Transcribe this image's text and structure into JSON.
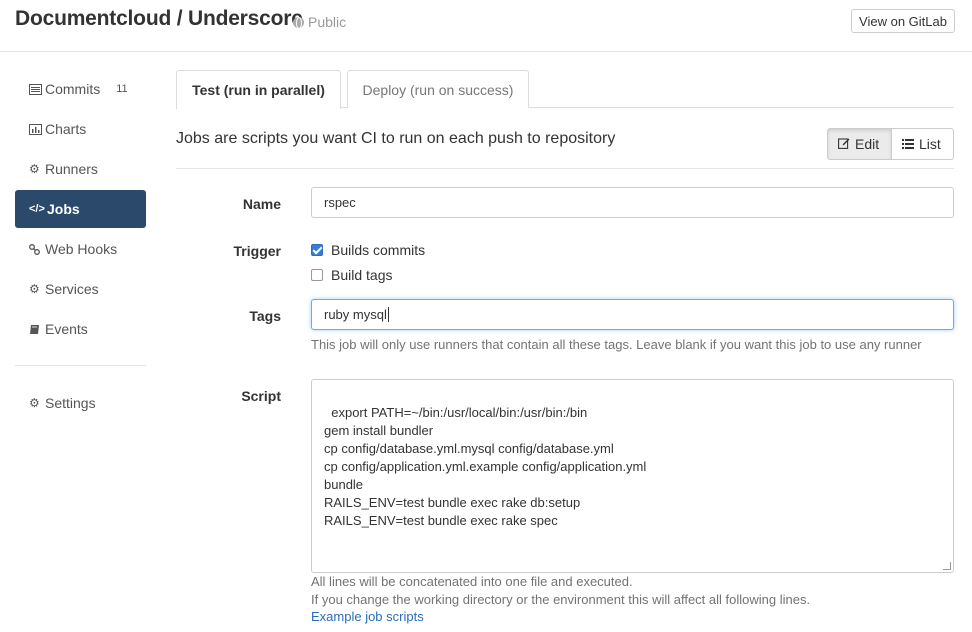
{
  "header": {
    "project_title": "Documentcloud / Underscore",
    "visibility": "Public",
    "gitlab_button": "View on GitLab"
  },
  "sidebar": {
    "items": [
      {
        "label": "Commits",
        "icon": "list-icon",
        "count": "11"
      },
      {
        "label": "Charts",
        "icon": "bar-chart-icon"
      },
      {
        "label": "Runners",
        "icon": "gear-icon"
      },
      {
        "label": "Jobs",
        "icon": "code-icon",
        "active": true
      },
      {
        "label": "Web Hooks",
        "icon": "link-icon"
      },
      {
        "label": "Services",
        "icon": "gear-icon"
      },
      {
        "label": "Events",
        "icon": "book-icon"
      }
    ],
    "settings": {
      "label": "Settings",
      "icon": "gears-icon"
    }
  },
  "tabs": [
    {
      "label": "Test (run in parallel)",
      "active": true
    },
    {
      "label": "Deploy (run on success)",
      "active": false
    }
  ],
  "main": {
    "heading": "Jobs are scripts you want CI to run on each push to repository",
    "edit_button": "Edit",
    "list_button": "List"
  },
  "form": {
    "name_label": "Name",
    "name_value": "rspec",
    "trigger_label": "Trigger",
    "builds_commits_label": "Builds commits",
    "builds_commits_checked": true,
    "build_tags_label": "Build tags",
    "build_tags_checked": false,
    "tags_label": "Tags",
    "tags_value": "ruby mysql",
    "tags_help": "This job will only use runners that contain all these tags. Leave blank if you want this job to use any runner",
    "script_label": "Script",
    "script_value": "export PATH=~/bin:/usr/local/bin:/usr/bin:/bin\ngem install bundler\ncp config/database.yml.mysql config/database.yml\ncp config/application.yml.example config/application.yml\nbundle\nRAILS_ENV=test bundle exec rake db:setup\nRAILS_ENV=test bundle exec rake spec",
    "script_help_1": "All lines will be concatenated into one file and executed.",
    "script_help_2": "If you change the working directory or the environment this will affect all following lines.",
    "example_link": "Example job scripts"
  },
  "colors": {
    "active_nav_bg": "#2b4a6b",
    "link": "#2a6ebb",
    "focus_border": "#66afe9",
    "checkbox_checked": "#3a7bd5"
  }
}
